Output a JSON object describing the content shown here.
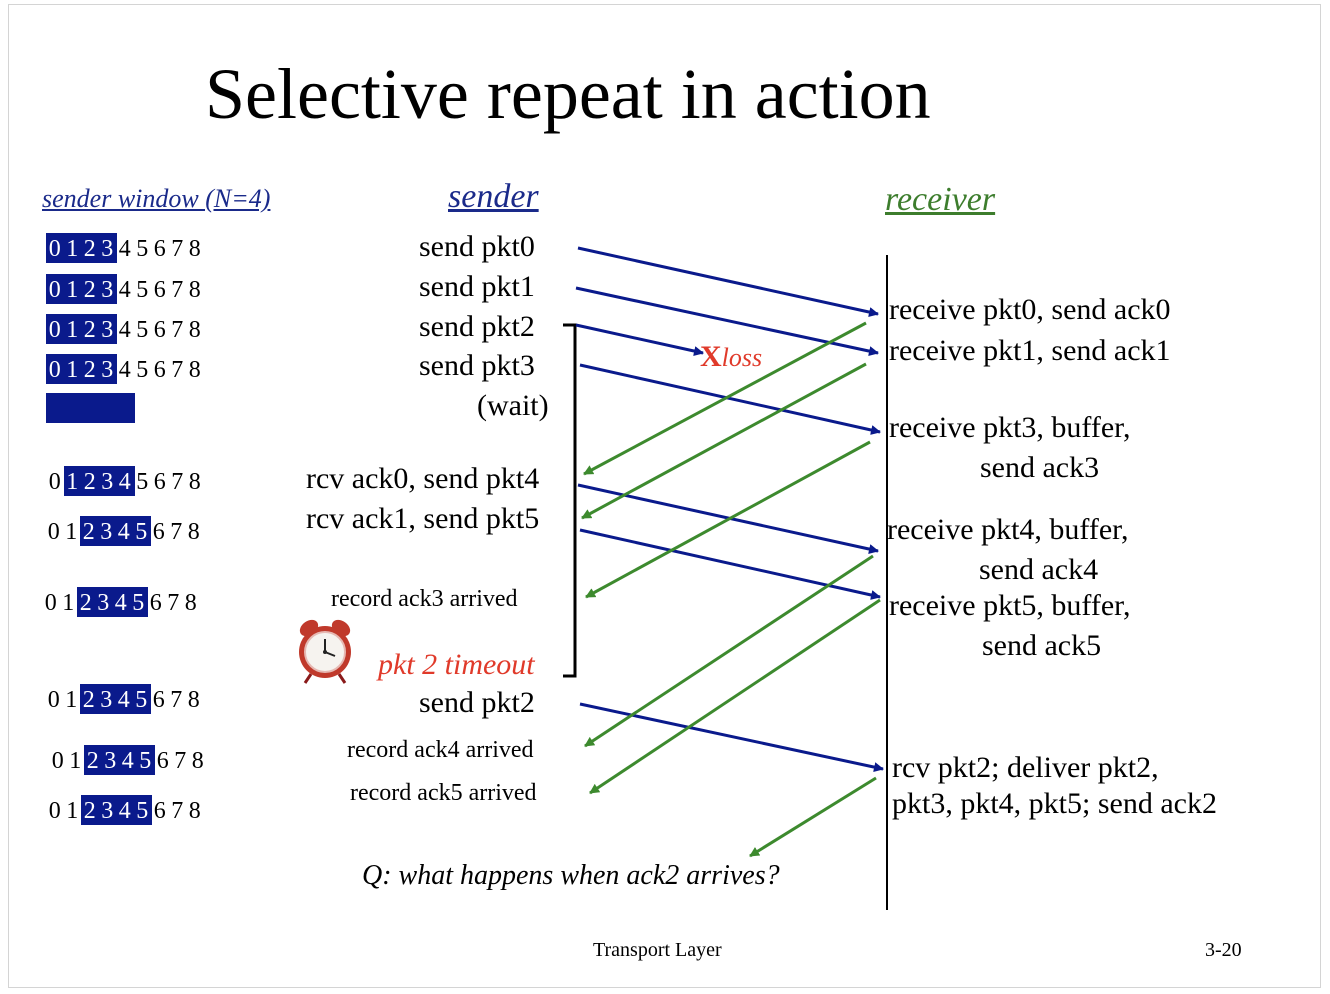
{
  "title": "Selective repeat in action",
  "headers": {
    "sender_window": "sender window (N=4)",
    "sender": "sender",
    "receiver": "receiver"
  },
  "windows": [
    {
      "digits": [
        "0",
        "1",
        "2",
        "3",
        "4",
        "5",
        "6",
        "7",
        "8"
      ],
      "start": 0,
      "size": 4
    },
    {
      "digits": [
        "0",
        "1",
        "2",
        "3",
        "4",
        "5",
        "6",
        "7",
        "8"
      ],
      "start": 0,
      "size": 4
    },
    {
      "digits": [
        "0",
        "1",
        "2",
        "3",
        "4",
        "5",
        "6",
        "7",
        "8"
      ],
      "start": 0,
      "size": 4
    },
    {
      "digits": [
        "0",
        "1",
        "2",
        "3",
        "4",
        "5",
        "6",
        "7",
        "8"
      ],
      "start": 0,
      "size": 4
    },
    {
      "digits": [],
      "start": 0,
      "size": 5
    },
    {
      "digits": [
        "0",
        "1",
        "2",
        "3",
        "4",
        "5",
        "6",
        "7",
        "8"
      ],
      "start": 1,
      "size": 4
    },
    {
      "digits": [
        "0",
        "1",
        "2",
        "3",
        "4",
        "5",
        "6",
        "7",
        "8"
      ],
      "start": 2,
      "size": 4
    },
    {
      "digits": [
        "0",
        "1",
        "2",
        "3",
        "4",
        "5",
        "6",
        "7",
        "8"
      ],
      "start": 2,
      "size": 4
    },
    {
      "digits": [
        "0",
        "1",
        "2",
        "3",
        "4",
        "5",
        "6",
        "7",
        "8"
      ],
      "start": 2,
      "size": 4
    },
    {
      "digits": [
        "0",
        "1",
        "2",
        "3",
        "4",
        "5",
        "6",
        "7",
        "8"
      ],
      "start": 2,
      "size": 4
    },
    {
      "digits": [
        "0",
        "1",
        "2",
        "3",
        "4",
        "5",
        "6",
        "7",
        "8"
      ],
      "start": 2,
      "size": 4
    }
  ],
  "sender_events": {
    "send_pkt0": "send  pkt0",
    "send_pkt1": "send  pkt1",
    "send_pkt2": "send  pkt2",
    "send_pkt3": "send  pkt3",
    "wait": "(wait)",
    "rcv_ack0": "rcv ack0, send pkt4",
    "rcv_ack1": "rcv ack1, send pkt5",
    "record_ack3": "record ack3 arrived",
    "timeout": "pkt 2 timeout",
    "resend_pkt2": "send  pkt2",
    "record_ack4": "record ack4 arrived",
    "record_ack5": "record ack5 arrived"
  },
  "receiver_events": {
    "pkt0": "receive pkt0, send ack0",
    "pkt1": "receive pkt1, send ack1",
    "pkt3_a": "receive pkt3, buffer,",
    "pkt3_b": "send ack3",
    "pkt4_a": "receive pkt4, buffer,",
    "pkt4_b": "send ack4",
    "pkt5_a": "receive pkt5, buffer,",
    "pkt5_b": "send ack5",
    "pkt2_a": "rcv pkt2; deliver pkt2,",
    "pkt2_b": "pkt3, pkt4, pkt5; send ack2"
  },
  "loss": {
    "mark": "X",
    "word": "loss"
  },
  "question": "Q: what happens when ack2 arrives?",
  "footer": {
    "center": "Transport Layer",
    "right": "3-20"
  },
  "icons": {
    "timer": "alarm-clock-icon"
  },
  "colors": {
    "packet_arrow": "#0a1a8c",
    "ack_arrow": "#3d8a2e",
    "window_highlight": "#0a1a8c",
    "loss": "#e03a2a",
    "receiver_header": "#3d7d2d",
    "sender_header": "#1a2a8a"
  }
}
